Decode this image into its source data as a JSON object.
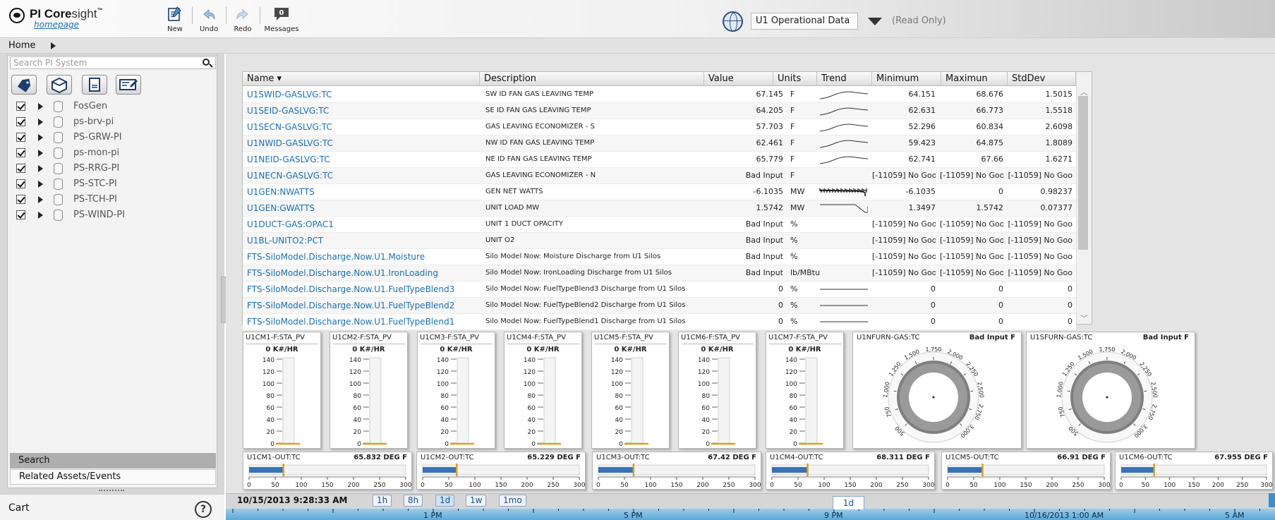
{
  "header": {
    "brand": "PI Coresight",
    "brand_bold": "PI Core",
    "brand_light": "sight",
    "brand_tm": "™",
    "home_link": "homepage",
    "toolbar": {
      "new": "New",
      "undo": "Undo",
      "redo": "Redo",
      "messages": "Messages",
      "messages_count": "0"
    },
    "dataset": "U1 Operational Data",
    "read_only": "(Read Only)"
  },
  "breadcrumb": "Home",
  "left_panel": {
    "search_placeholder": "Search PI System",
    "servers": [
      "FosGen",
      "ps-brv-pi",
      "PS-GRW-PI",
      "ps-mon-pi",
      "PS-RRG-PI",
      "PS-STC-PI",
      "PS-TCH-PI",
      "PS-WIND-PI"
    ],
    "search_tab": "Search",
    "related_tab": "Related Assets/Events",
    "cart": "Cart",
    "help": "?"
  },
  "table": {
    "columns": [
      "Name ▾",
      "Description",
      "Value",
      "Units",
      "Trend",
      "Minimum",
      "Maximun",
      "StdDev"
    ],
    "rows": [
      {
        "name": "U1SWID-GASLVG:TC",
        "desc": "SW ID FAN GAS LEAVING TEMP",
        "value": "67.145",
        "units": "F",
        "min": "64.151",
        "max": "68.676",
        "std": "1.5015",
        "trend": "rise"
      },
      {
        "name": "U1SEID-GASLVG:TC",
        "desc": "SE ID FAN GAS LEAVING TEMP",
        "value": "64.205",
        "units": "F",
        "min": "62.631",
        "max": "66.773",
        "std": "1.5518",
        "trend": "rise"
      },
      {
        "name": "U1SECN-GASLVG:TC",
        "desc": "GAS LEAVING ECONOMIZER - S",
        "value": "57.703",
        "units": "F",
        "min": "52.296",
        "max": "60.834",
        "std": "2.6098",
        "trend": "rise"
      },
      {
        "name": "U1NWID-GASLVG:TC",
        "desc": "NW ID FAN GAS LEAVING TEMP",
        "value": "62.461",
        "units": "F",
        "min": "59.423",
        "max": "64.875",
        "std": "1.8089",
        "trend": "rise"
      },
      {
        "name": "U1NEID-GASLVG:TC",
        "desc": "NE ID FAN GAS LEAVING TEMP",
        "value": "65.779",
        "units": "F",
        "min": "62.741",
        "max": "67.66",
        "std": "1.6271",
        "trend": "rise"
      },
      {
        "name": "U1NECN-GASLVG:TC",
        "desc": "GAS LEAVING ECONOMIZER - N",
        "value": "Bad Input",
        "units": "F",
        "min": "[-11059] No Goo",
        "max": "[-11059] No Goo",
        "std": "[-11059] No Goo",
        "trend": "none"
      },
      {
        "name": "U1GEN:NWATTS",
        "desc": "GEN NET WATTS",
        "value": "-6.1035",
        "units": "MW",
        "min": "-6.1035",
        "max": "0",
        "std": "0.98237",
        "trend": "noisy"
      },
      {
        "name": "U1GEN:GWATTS",
        "desc": "UNIT LOAD MW",
        "value": "1.5742",
        "units": "MW",
        "min": "1.3497",
        "max": "1.5742",
        "std": "0.07377",
        "trend": "step"
      },
      {
        "name": "U1DUCT-GAS:OPAC1",
        "desc": "UNIT 1 DUCT OPACITY",
        "value": "Bad Input",
        "units": "%",
        "min": "[-11059] No Goo",
        "max": "[-11059] No Goo",
        "std": "[-11059] No Goo",
        "trend": "none"
      },
      {
        "name": "U1BL-UNITO2:PCT",
        "desc": "UNIT O2",
        "value": "Bad Input",
        "units": "%",
        "min": "[-11059] No Goo",
        "max": "[-11059] No Goo",
        "std": "[-11059] No Goo",
        "trend": "none"
      },
      {
        "name": "FTS-SiloModel.Discharge.Now.U1.Moisture",
        "desc": "Silo Model Now: Moisture Discharge from U1 Silos",
        "value": "Bad Input",
        "units": "%",
        "min": "[-11059] No Goo",
        "max": "[-11059] No Goo",
        "std": "[-11059] No Goo",
        "trend": "none"
      },
      {
        "name": "FTS-SiloModel.Discharge.Now.U1.IronLoading",
        "desc": "Silo Model Now: IronLoading Discharge from U1 Silos",
        "value": "Bad Input",
        "units": "lb/MBtu",
        "min": "[-11059] No Goo",
        "max": "[-11059] No Goo",
        "std": "[-11059] No Goo",
        "trend": "none"
      },
      {
        "name": "FTS-SiloModel.Discharge.Now.U1.FuelTypeBlend3",
        "desc": "Silo Model Now: FuelTypeBlend3 Discharge from U1 Silos",
        "value": "0",
        "units": "%",
        "min": "0",
        "max": "0",
        "std": "0",
        "trend": "flat"
      },
      {
        "name": "FTS-SiloModel.Discharge.Now.U1.FuelTypeBlend2",
        "desc": "Silo Model Now: FuelTypeBlend2 Discharge from U1 Silos",
        "value": "0",
        "units": "%",
        "min": "0",
        "max": "0",
        "std": "0",
        "trend": "flat"
      },
      {
        "name": "FTS-SiloModel.Discharge.Now.U1.FuelTypeBlend1",
        "desc": "Silo Model Now: FuelTypeBlend1 Discharge from U1 Silos",
        "value": "0",
        "units": "%",
        "min": "0",
        "max": "0",
        "std": "0",
        "trend": "flat"
      }
    ]
  },
  "vertical_gauges": {
    "ticks": [
      "140",
      "120",
      "100",
      "80",
      "60",
      "40",
      "20",
      "0"
    ],
    "max": 140,
    "items": [
      {
        "title": "U1CM1-F:STA_PV",
        "value_label": "0 K#/HR",
        "value": 0
      },
      {
        "title": "U1CM2-F:STA_PV",
        "value_label": "0 K#/HR",
        "value": 0
      },
      {
        "title": "U1CM3-F:STA_PV",
        "value_label": "0 K#/HR",
        "value": 0
      },
      {
        "title": "U1CM4-F:STA_PV",
        "value_label": "0 K#/HR",
        "value": 0
      },
      {
        "title": "U1CM5-F:STA_PV",
        "value_label": "0 K#/HR",
        "value": 0
      },
      {
        "title": "U1CM6-F:STA_PV",
        "value_label": "0 K#/HR",
        "value": 0
      },
      {
        "title": "U1CM7-F:STA_PV",
        "value_label": "0 K#/HR",
        "value": 0
      }
    ]
  },
  "dial_gauges": [
    {
      "title": "U1NFURN-GAS:TC",
      "status": "Bad Input F"
    },
    {
      "title": "U1SFURN-GAS:TC",
      "status": "Bad Input F"
    }
  ],
  "dial_ticks": [
    "500",
    "750",
    "1,000",
    "1,250",
    "1,500",
    "1,750",
    "2,000",
    "2,250",
    "2,500",
    "2,750",
    "3,000"
  ],
  "horizontal_gauges": {
    "ticks": [
      "0",
      "50",
      "100",
      "150",
      "200",
      "250",
      "300"
    ],
    "max": 300,
    "items": [
      {
        "title": "U1CM1-OUT:TC",
        "value_label": "65.832 DEG F",
        "value": 65.832
      },
      {
        "title": "U1CM2-OUT:TC",
        "value_label": "65.229 DEG F",
        "value": 65.229
      },
      {
        "title": "U1CM3-OUT:TC",
        "value_label": "67.42 DEG F",
        "value": 67.42
      },
      {
        "title": "U1CM4-OUT:TC",
        "value_label": "68.311 DEG F",
        "value": 68.311
      },
      {
        "title": "U1CM5-OUT:TC",
        "value_label": "66.91 DEG F",
        "value": 66.91
      },
      {
        "title": "U1CM6-OUT:TC",
        "value_label": "67.955 DEG F",
        "value": 67.955
      }
    ]
  },
  "timebar": {
    "current_time": "10/15/2013 9:28:33 AM",
    "ranges": [
      "1h",
      "8h",
      "1d",
      "1w",
      "1mo"
    ],
    "selected_range": "1d",
    "timeline_tab": "1d",
    "timeline_labels": [
      "1 PM",
      "5 PM",
      "9 PM",
      "10/16/2013 1:00 AM",
      "5 AM"
    ]
  },
  "colors": {
    "link": "#1a6fb5",
    "accent": "#3a8fcf",
    "gauge_bar": "#3672b8",
    "gauge_marker": "#d8a21c"
  }
}
